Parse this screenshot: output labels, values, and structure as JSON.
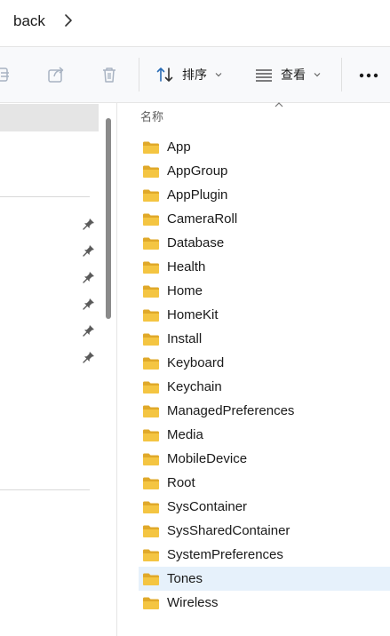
{
  "address": {
    "crumb": "back"
  },
  "toolbar": {
    "sort_label": "排序",
    "view_label": "查看"
  },
  "filelist": {
    "column_header": "名称",
    "selected_index": 18,
    "folders": [
      {
        "name": "App"
      },
      {
        "name": "AppGroup"
      },
      {
        "name": "AppPlugin"
      },
      {
        "name": "CameraRoll"
      },
      {
        "name": "Database"
      },
      {
        "name": "Health"
      },
      {
        "name": "Home"
      },
      {
        "name": "HomeKit"
      },
      {
        "name": "Install"
      },
      {
        "name": "Keyboard"
      },
      {
        "name": "Keychain"
      },
      {
        "name": "ManagedPreferences"
      },
      {
        "name": "Media"
      },
      {
        "name": "MobileDevice"
      },
      {
        "name": "Root"
      },
      {
        "name": "SysContainer"
      },
      {
        "name": "SysSharedContainer"
      },
      {
        "name": "SystemPreferences"
      },
      {
        "name": "Tones"
      },
      {
        "name": "Wireless"
      }
    ]
  },
  "colors": {
    "accent_folder": "#f4c542",
    "selection": "#e6f1fb",
    "nav_selection": "#e5e5e5"
  },
  "icons": {
    "crumb_separator": "chevron-right-icon",
    "toolbar": [
      "copy-path-icon",
      "share-icon",
      "delete-icon",
      "sort-icon",
      "view-icon",
      "more-icon"
    ],
    "nav_pins": [
      "pin-icon",
      "pin-icon",
      "pin-icon",
      "pin-icon",
      "pin-icon",
      "pin-icon"
    ]
  }
}
